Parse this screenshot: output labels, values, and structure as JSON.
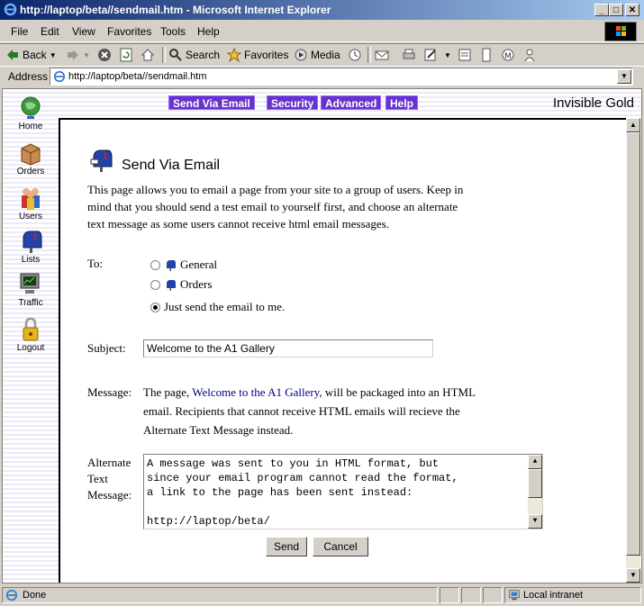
{
  "window": {
    "title": "http://laptop/beta//sendmail.htm - Microsoft Internet Explorer",
    "controls": {
      "minimize": "_",
      "maximize": "□",
      "close": "✕"
    }
  },
  "menu": [
    "File",
    "Edit",
    "View",
    "Favorites",
    "Tools",
    "Help"
  ],
  "toolbar": {
    "back": "Back",
    "search": "Search",
    "favorites": "Favorites",
    "media": "Media"
  },
  "address": {
    "label": "Address",
    "url": "http://laptop/beta//sendmail.htm"
  },
  "sidenav": [
    "Home",
    "Orders",
    "Users",
    "Lists",
    "Traffic",
    "Logout"
  ],
  "tabs": [
    "Send Via Email",
    "Security",
    "Advanced",
    "Help"
  ],
  "brand": "Invisible Gold",
  "page": {
    "heading": "Send Via Email",
    "intro_lines": [
      "This page allows you to email a page from your site to a group of users. Keep in",
      "mind that you should send a test email to yourself first, and choose an alternate",
      "text message as some users cannot receive html email messages."
    ],
    "to_label": "To:",
    "recipients": [
      {
        "label": "General",
        "selected": false
      },
      {
        "label": "Orders",
        "selected": false
      },
      {
        "label": "Just send the email to me.",
        "selected": true
      }
    ],
    "subject_label": "Subject:",
    "subject_value": "Welcome to the A1 Gallery",
    "message_label": "Message:",
    "message_pre": "The page, ",
    "message_link": "Welcome to the A1 Gallery",
    "message_post": ", will be packaged into an HTML",
    "message_line2": "email. Recipients that cannot receive HTML emails will recieve the",
    "message_line3": "Alternate Text Message instead.",
    "alt_label_lines": [
      "Alternate",
      "Text",
      "Message:"
    ],
    "alt_text": "A message was sent to you in HTML format, but\nsince your email program cannot read the format,\na link to the page has been sent instead:\n\nhttp://laptop/beta/",
    "send_button": "Send",
    "cancel_button": "Cancel"
  },
  "status": {
    "text": "Done",
    "zone": "Local intranet"
  },
  "colors": {
    "tab_bg": "#6633cc",
    "titlebar_start": "#0a246a",
    "link": "#000080"
  }
}
